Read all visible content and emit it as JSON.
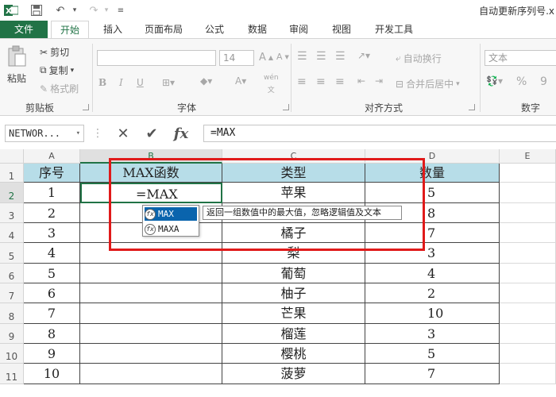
{
  "window": {
    "title": "自动更新序列号.x"
  },
  "tabs": [
    "文件",
    "开始",
    "插入",
    "页面布局",
    "公式",
    "数据",
    "审阅",
    "视图",
    "开发工具"
  ],
  "ribbon": {
    "clipboard": {
      "paste": "粘贴",
      "cut": "剪切",
      "copy": "复制",
      "format_painter": "格式刷",
      "group": "剪贴板"
    },
    "font": {
      "size": "14",
      "group": "字体",
      "phonetic": "wén"
    },
    "alignment": {
      "wrap": "自动换行",
      "merge": "合并后居中",
      "group": "对齐方式"
    },
    "number": {
      "format": "文本",
      "percent": "%",
      "comma": "9",
      "group": "数字"
    }
  },
  "formula_bar": {
    "name_box": "NETWOR...",
    "formula": "=MAX",
    "fx": "fx"
  },
  "columns": [
    "A",
    "B",
    "C",
    "D",
    "E"
  ],
  "rows": [
    "1",
    "2",
    "3",
    "4",
    "5",
    "6",
    "7",
    "8",
    "9",
    "10",
    "11"
  ],
  "table": {
    "headers": [
      "序号",
      "MAX函数",
      "类型",
      "数量"
    ],
    "rows": [
      [
        "1",
        "=MAX",
        "苹果",
        "5"
      ],
      [
        "2",
        "",
        "",
        "8"
      ],
      [
        "3",
        "",
        "橘子",
        "7"
      ],
      [
        "4",
        "",
        "梨",
        "3"
      ],
      [
        "5",
        "",
        "葡萄",
        "4"
      ],
      [
        "6",
        "",
        "柚子",
        "2"
      ],
      [
        "7",
        "",
        "芒果",
        "10"
      ],
      [
        "8",
        "",
        "榴莲",
        "3"
      ],
      [
        "9",
        "",
        "樱桃",
        "5"
      ],
      [
        "10",
        "",
        "菠萝",
        "7"
      ]
    ]
  },
  "autocomplete": {
    "items": [
      "MAX",
      "MAXA"
    ],
    "tooltip": "返回一组数值中的最大值，忽略逻辑值及文本"
  },
  "colors": {
    "accent": "#217346",
    "header_fill": "#b7dde8",
    "highlight": "#e01a1a"
  }
}
